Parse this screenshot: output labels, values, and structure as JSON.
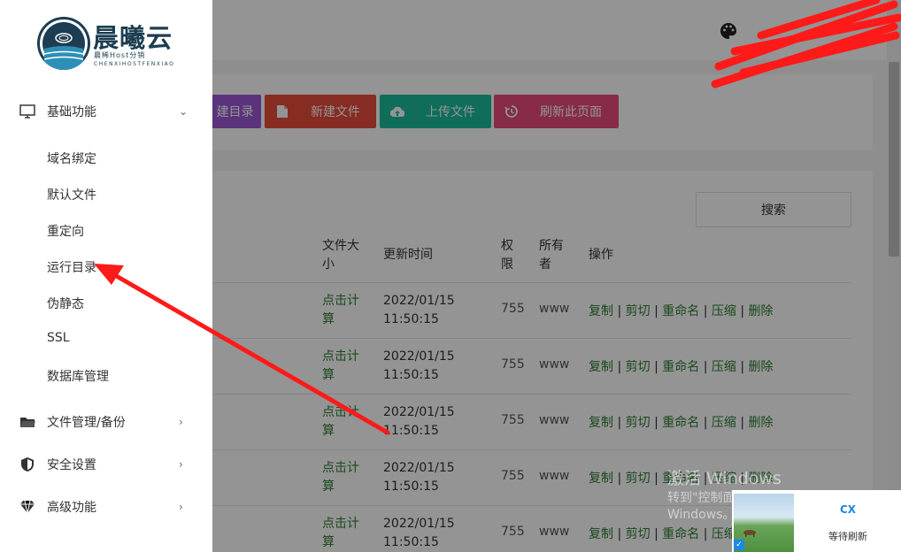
{
  "brand": {
    "name": "晨曦云",
    "subtitle": "晨稀Host分销",
    "subtitle2": "CHENXIHOSTFENXIAO"
  },
  "sidebar": {
    "groups": [
      {
        "label": "基础功能",
        "icon": "monitor-icon",
        "arrow": "⌄"
      },
      {
        "label": "文件管理/备份",
        "icon": "folder-icon",
        "arrow": "›"
      },
      {
        "label": "安全设置",
        "icon": "shield-icon",
        "arrow": "›"
      },
      {
        "label": "高级功能",
        "icon": "diamond-icon",
        "arrow": "›"
      }
    ],
    "sub_items": [
      "域名绑定",
      "默认文件",
      "重定向",
      "运行目录",
      "伪静态",
      "SSL",
      "数据库管理"
    ]
  },
  "toolbar": {
    "new_dir": "建目录",
    "new_file": "新建文件",
    "upload": "上传文件",
    "refresh": "刷新此页面"
  },
  "search": {
    "label": "搜索"
  },
  "table": {
    "headers": {
      "size": "文件大小",
      "time": "更新时间",
      "perm": "权限",
      "owner": "所有者",
      "ops": "操作"
    },
    "rows": [
      {
        "size": "点击计算",
        "date": "2022/01/15",
        "clock": "11:50:15",
        "perm": "755",
        "owner": "www"
      },
      {
        "size": "点击计算",
        "date": "2022/01/15",
        "clock": "11:50:15",
        "perm": "755",
        "owner": "www"
      },
      {
        "size": "点击计算",
        "date": "2022/01/15",
        "clock": "11:50:15",
        "perm": "755",
        "owner": "www"
      },
      {
        "size": "点击计算",
        "date": "2022/01/15",
        "clock": "11:50:15",
        "perm": "755",
        "owner": "www"
      },
      {
        "size": "点击计算",
        "date": "2022/01/15",
        "clock": "11:50:15",
        "perm": "755",
        "owner": "www"
      }
    ],
    "ops": {
      "copy": "复制",
      "cut": "剪切",
      "rename": "重命名",
      "compress": "压缩",
      "delete": "删除",
      "sep": "|"
    }
  },
  "watermark": {
    "line1": "激活 Windows",
    "line2": "转到\"控制面板\"中的\"系统\"以激活",
    "line3": "Windows。"
  },
  "widget": {
    "logo": "CX",
    "status": "等待刷新"
  },
  "colors": {
    "new_dir": "#9b59d6",
    "new_file": "#e74c3c",
    "upload": "#1abc9c",
    "refresh": "#e84a7a",
    "link_green": "#2e7d32",
    "annotation_red": "#ff1a1a"
  }
}
